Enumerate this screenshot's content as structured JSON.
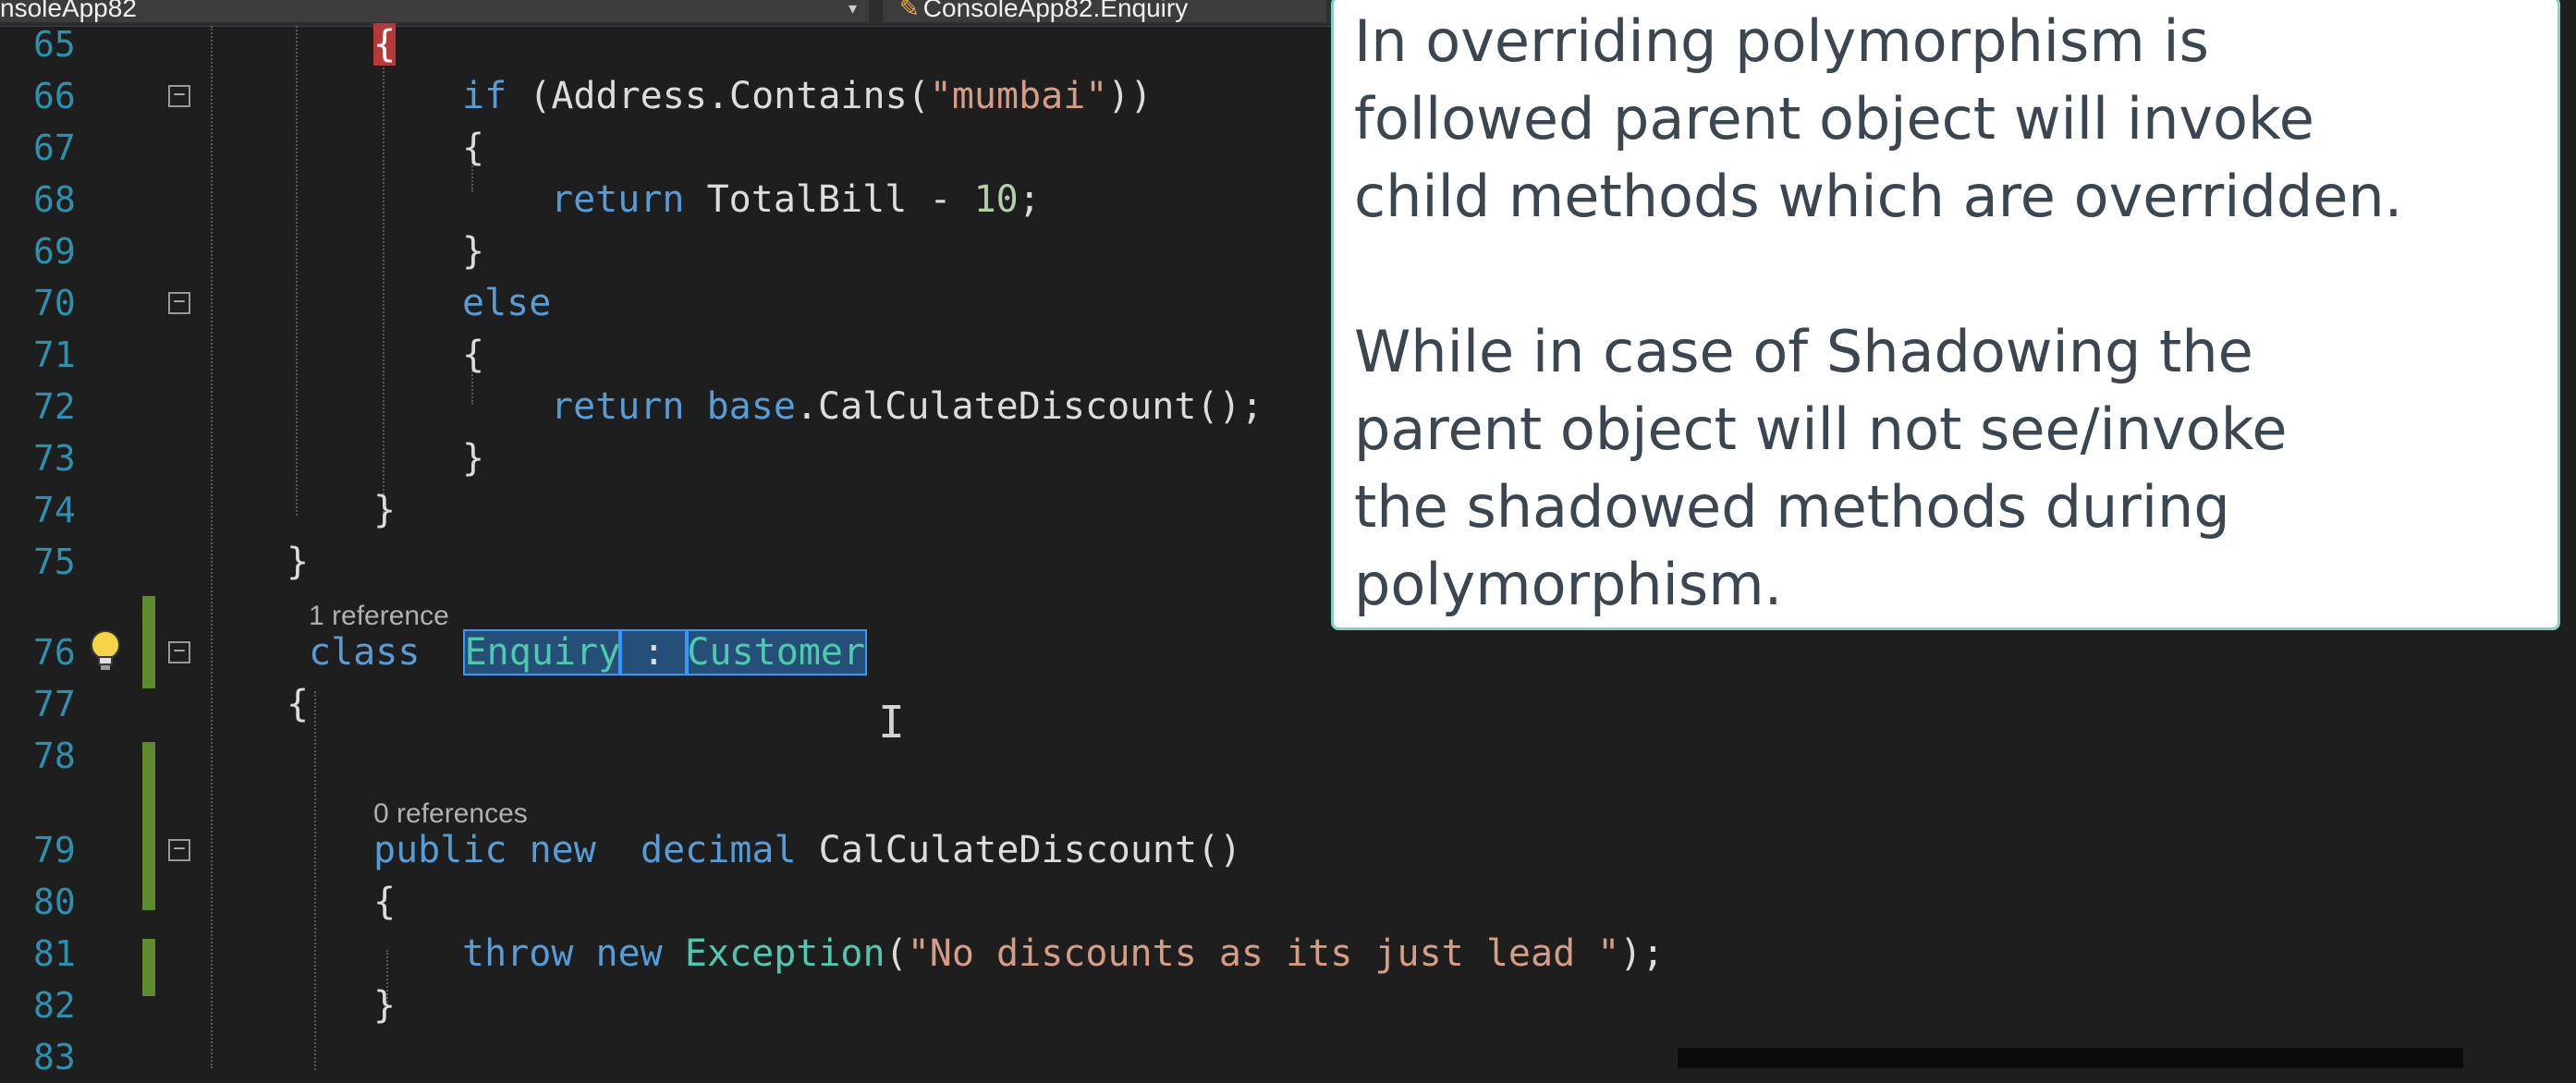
{
  "nav": {
    "project": "nsoleApp82",
    "class": "ConsoleApp82.Enquiry",
    "class_icon": "class-icon"
  },
  "code_lines": [
    {
      "n": "65"
    },
    {
      "n": "66"
    },
    {
      "n": "67"
    },
    {
      "n": "68"
    },
    {
      "n": "69"
    },
    {
      "n": "70"
    },
    {
      "n": "71"
    },
    {
      "n": "72"
    },
    {
      "n": "73"
    },
    {
      "n": "74"
    },
    {
      "n": "75"
    },
    {
      "n": "76"
    },
    {
      "n": "77"
    },
    {
      "n": "78"
    },
    {
      "n": "79"
    },
    {
      "n": "80"
    },
    {
      "n": "81"
    },
    {
      "n": "82"
    },
    {
      "n": "83"
    }
  ],
  "code": {
    "l65": "{",
    "l66_if": "if",
    "l66_a": " (Address.Contains(",
    "l66_str": "\"mumbai\"",
    "l66_b": "))",
    "l67": "{",
    "l68_kw": "return",
    "l68_a": " TotalBill - ",
    "l68_num": "10",
    "l68_b": ";",
    "l69": "}",
    "l70": "else",
    "l71": "{",
    "l72_kw": "return",
    "l72_sp": " ",
    "l72_base": "base",
    "l72_a": ".CalCulateDiscount();",
    "l73": "}",
    "l74": "}",
    "l75": "}",
    "l76_kw": "class",
    "l76_sp": "  ",
    "l76_cls": "Enquiry",
    "l76_colon": " : ",
    "l76_base": "Customer",
    "l77": "{",
    "l79_kw1": "public",
    "l79_sp1": " ",
    "l79_kw2": "new",
    "l79_sp2": "  ",
    "l79_kw3": "decimal",
    "l79_a": " CalCulateDiscount()",
    "l80": "{",
    "l81_kw1": "throw",
    "l81_sp1": " ",
    "l81_kw2": "new",
    "l81_sp2": " ",
    "l81_type": "Exception",
    "l81_a": "(",
    "l81_str": "\"No discounts as its just lead \"",
    "l81_b": ");",
    "l82": "}"
  },
  "codelens": {
    "class_refs": "1 reference",
    "method_refs": "0 references"
  },
  "callout": {
    "para1": "In overriding polymorphism is followed parent object will invoke child methods which are overridden.",
    "para1_lines": [
      "In overriding polymorphism is",
      "followed parent object will invoke",
      "child methods which are overridden."
    ],
    "para2_lines": [
      "While in case of Shadowing the",
      "parent object will not see/invoke",
      "the shadowed methods during",
      "polymorphism."
    ]
  },
  "icons": {
    "bulb": "lightbulb-icon",
    "collapse": "collapse-icon",
    "cursor": "text-cursor-icon"
  }
}
